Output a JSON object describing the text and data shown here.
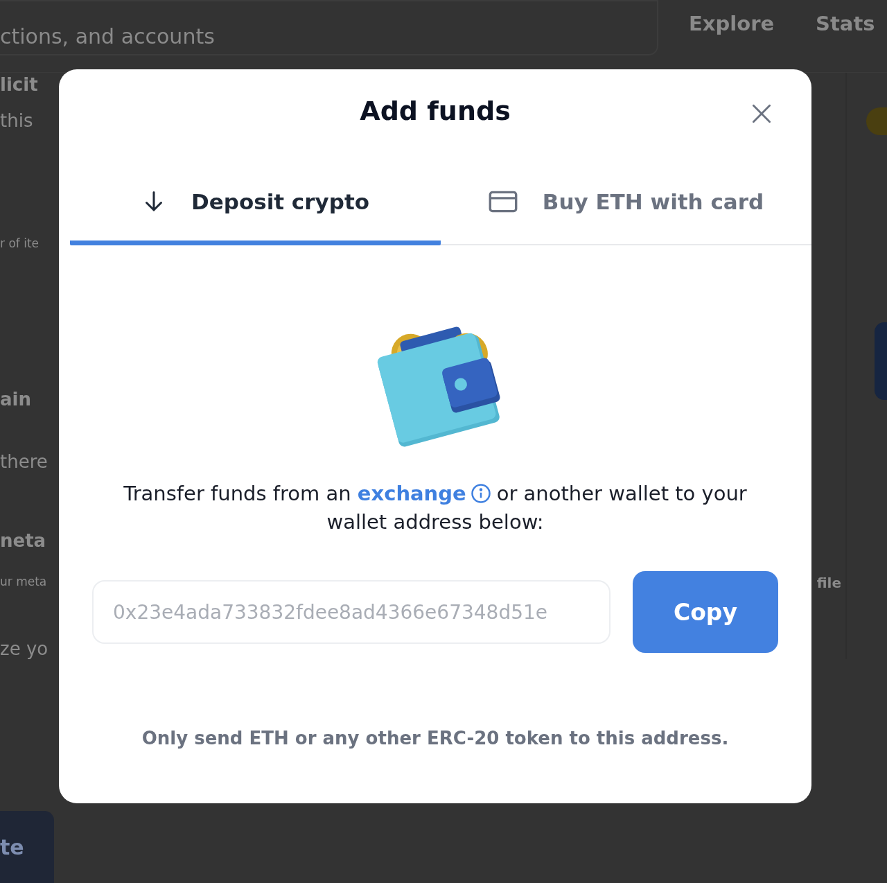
{
  "background": {
    "search": {
      "placeholder": "ctions, and accounts"
    },
    "nav": [
      "Explore",
      "Stats"
    ],
    "left_column": [
      {
        "text": "licit",
        "kind": "heading"
      },
      {
        "text": "this",
        "kind": "body"
      },
      {
        "text": "r of ite",
        "kind": "small"
      },
      {
        "text": "ain",
        "kind": "heading"
      },
      {
        "text": "there",
        "kind": "body"
      },
      {
        "text": "neta",
        "kind": "heading"
      },
      {
        "text": "ur meta",
        "kind": "small"
      },
      {
        "text": "ze yo",
        "kind": "body"
      }
    ],
    "right_column": [
      "file"
    ],
    "button": "te"
  },
  "modal": {
    "title": "Add funds",
    "tabs": [
      {
        "label": "Deposit crypto",
        "kind": "deposit",
        "selected": true
      },
      {
        "label": "Buy ETH with card",
        "kind": "card",
        "selected": false
      }
    ],
    "message": {
      "before": "Transfer funds from an",
      "link": "exchange",
      "after": "or another wallet to your wallet address below:"
    },
    "address": {
      "value": "0x23e4ada733832fdee8ad4366e67348d51e"
    },
    "copy_button": "Copy",
    "note": "Only send ETH or any other ERC-20 token to this address."
  }
}
